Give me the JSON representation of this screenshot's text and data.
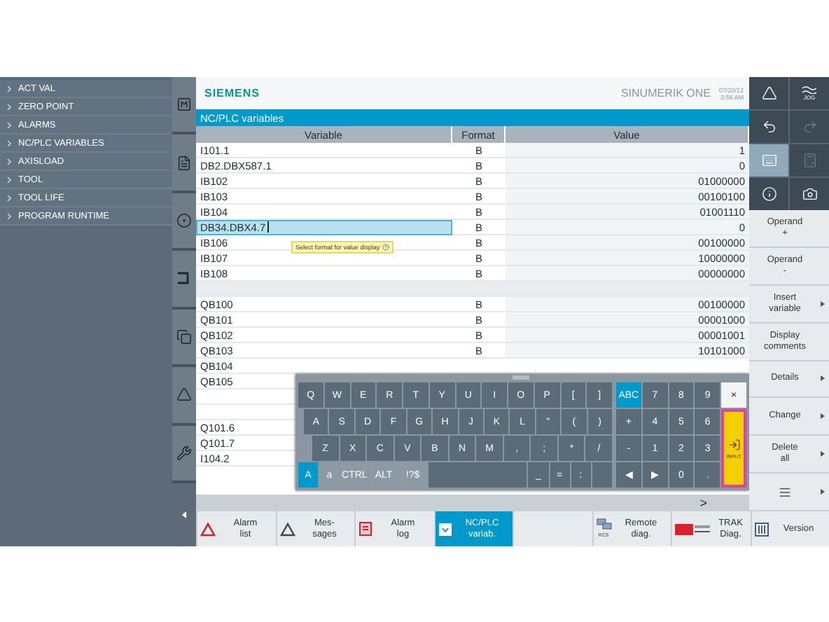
{
  "sidebar": {
    "items": [
      {
        "label": "ACT VAL"
      },
      {
        "label": "ZERO POINT"
      },
      {
        "label": "ALARMS"
      },
      {
        "label": "NC/PLC VARIABLES"
      },
      {
        "label": "AXISLOAD"
      },
      {
        "label": "TOOL"
      },
      {
        "label": "TOOL LIFE"
      },
      {
        "label": "PROGRAM RUNTIME"
      }
    ]
  },
  "header": {
    "brand": "SIEMENS",
    "product": "SINUMERIK ONE",
    "date": "07/20/12",
    "time": "3:56 AM"
  },
  "panel": {
    "title": "NC/PLC variables",
    "columns": [
      "Variable",
      "Format",
      "Value"
    ],
    "tooltip": "Select format for value display",
    "rows": [
      {
        "kind": "data",
        "variable": "I101.1",
        "format": "B",
        "value": "1",
        "selected": false
      },
      {
        "kind": "data",
        "variable": "DB2.DBX587.1",
        "format": "B",
        "value": "0",
        "selected": false
      },
      {
        "kind": "data",
        "variable": "IB102",
        "format": "B",
        "value": "01000000",
        "selected": false
      },
      {
        "kind": "data",
        "variable": "IB103",
        "format": "B",
        "value": "00100100",
        "selected": false
      },
      {
        "kind": "data",
        "variable": "IB104",
        "format": "B",
        "value": "01001110",
        "selected": false
      },
      {
        "kind": "data",
        "variable": "DB34.DBX4.7",
        "format": "B",
        "value": "0",
        "selected": true
      },
      {
        "kind": "data",
        "variable": "IB106",
        "format": "B",
        "value": "00100000",
        "selected": false
      },
      {
        "kind": "data",
        "variable": "IB107",
        "format": "B",
        "value": "10000000",
        "selected": false
      },
      {
        "kind": "data",
        "variable": "IB108",
        "format": "B",
        "value": "00000000",
        "selected": false
      },
      {
        "kind": "group",
        "selected": false
      },
      {
        "kind": "data",
        "variable": "QB100",
        "format": "B",
        "value": "00100000",
        "selected": false
      },
      {
        "kind": "data",
        "variable": "QB101",
        "format": "B",
        "value": "00001000",
        "selected": false
      },
      {
        "kind": "data",
        "variable": "QB102",
        "format": "B",
        "value": "00001001",
        "selected": false
      },
      {
        "kind": "data",
        "variable": "QB103",
        "format": "B",
        "value": "10101000",
        "selected": false
      },
      {
        "kind": "data",
        "variable": "QB104",
        "selected": false
      },
      {
        "kind": "data",
        "variable": "QB105",
        "selected": false
      },
      {
        "kind": "blank",
        "selected": false
      },
      {
        "kind": "blank",
        "selected": false
      },
      {
        "kind": "data",
        "variable": "Q101.6",
        "selected": false
      },
      {
        "kind": "data",
        "variable": "Q101.7",
        "selected": false
      },
      {
        "kind": "data",
        "variable": "I104.2",
        "selected": false
      }
    ],
    "page_arrow": ">"
  },
  "keyboard": {
    "input_label": "INPUT",
    "rows": [
      {
        "keys": [
          {
            "kind": "key",
            "label": "Q"
          },
          {
            "kind": "key",
            "label": "W"
          },
          {
            "kind": "key",
            "label": "E"
          },
          {
            "kind": "key",
            "label": "R"
          },
          {
            "kind": "key",
            "label": "T"
          },
          {
            "kind": "key",
            "label": "Y"
          },
          {
            "kind": "key",
            "label": "U"
          },
          {
            "kind": "key",
            "label": "I"
          },
          {
            "kind": "key",
            "label": "O"
          },
          {
            "kind": "key",
            "label": "P"
          },
          {
            "kind": "key",
            "label": "["
          },
          {
            "kind": "key",
            "label": "]"
          }
        ]
      },
      {
        "keys": [
          {
            "kind": "key",
            "label": "A"
          },
          {
            "kind": "key",
            "label": "S"
          },
          {
            "kind": "key",
            "label": "D"
          },
          {
            "kind": "key",
            "label": "F"
          },
          {
            "kind": "key",
            "label": "G"
          },
          {
            "kind": "key",
            "label": "H"
          },
          {
            "kind": "key",
            "label": "J"
          },
          {
            "kind": "key",
            "label": "K"
          },
          {
            "kind": "key",
            "label": "L"
          },
          {
            "kind": "key",
            "label": "\""
          },
          {
            "kind": "key",
            "label": "("
          },
          {
            "kind": "key",
            "label": ")"
          }
        ]
      },
      {
        "keys": [
          {
            "kind": "key",
            "label": "Z"
          },
          {
            "kind": "key",
            "label": "X"
          },
          {
            "kind": "key",
            "label": "C"
          },
          {
            "kind": "key",
            "label": "V"
          },
          {
            "kind": "key",
            "label": "B"
          },
          {
            "kind": "key",
            "label": "N"
          },
          {
            "kind": "key",
            "label": "M"
          },
          {
            "kind": "key",
            "label": ","
          },
          {
            "kind": "key",
            "label": ";"
          },
          {
            "kind": "key",
            "label": "*"
          },
          {
            "kind": "key",
            "label": "/"
          }
        ]
      },
      {
        "keys": [
          {
            "kind": "toggle",
            "label": "A",
            "selected": true
          },
          {
            "kind": "toggle",
            "label": "a",
            "selected": false
          },
          {
            "kind": "toggle",
            "label": "CTRL",
            "selected": false
          },
          {
            "kind": "toggle",
            "label": "ALT",
            "selected": false
          },
          {
            "kind": "toggle",
            "label": "!?$",
            "selected": false
          },
          {
            "kind": "space"
          },
          {
            "kind": "key",
            "label": "_"
          },
          {
            "kind": "key",
            "label": "="
          },
          {
            "kind": "key",
            "label": ":"
          },
          {
            "kind": "blank"
          }
        ]
      }
    ],
    "numpad": [
      {
        "keys": [
          {
            "kind": "toggle",
            "label": "ABC",
            "selected": true
          },
          {
            "kind": "key",
            "label": "7"
          },
          {
            "kind": "key",
            "label": "8"
          },
          {
            "kind": "key",
            "label": "9"
          },
          {
            "kind": "close",
            "label": "×"
          }
        ]
      },
      {
        "keys": [
          {
            "kind": "key",
            "label": "+"
          },
          {
            "kind": "key",
            "label": "4"
          },
          {
            "kind": "key",
            "label": "5"
          },
          {
            "kind": "key",
            "label": "6"
          }
        ]
      },
      {
        "keys": [
          {
            "kind": "key",
            "label": "-"
          },
          {
            "kind": "key",
            "label": "1"
          },
          {
            "kind": "key",
            "label": "2"
          },
          {
            "kind": "key",
            "label": "3"
          }
        ]
      },
      {
        "keys": [
          {
            "kind": "key",
            "label": "◀"
          },
          {
            "kind": "key",
            "label": "▶"
          },
          {
            "kind": "key",
            "label": "0"
          },
          {
            "kind": "key",
            "label": "."
          }
        ]
      }
    ]
  },
  "quick_buttons": [
    {
      "kind": "machine",
      "selected": false,
      "disabled": false
    },
    {
      "kind": "jog",
      "label": "JOG",
      "selected": false,
      "disabled": false
    },
    {
      "kind": "undo",
      "selected": false,
      "disabled": false
    },
    {
      "kind": "redo",
      "selected": false,
      "disabled": true
    },
    {
      "kind": "keyboard",
      "selected": true,
      "disabled": false
    },
    {
      "kind": "calculator",
      "selected": false,
      "disabled": true
    },
    {
      "kind": "info",
      "selected": false,
      "disabled": false
    },
    {
      "kind": "screenshot",
      "selected": false,
      "disabled": false
    }
  ],
  "softkeys": [
    {
      "kind": "text",
      "label": "Operand\n+",
      "arrow": false
    },
    {
      "kind": "text",
      "label": "Operand\n-",
      "arrow": false
    },
    {
      "kind": "text",
      "label": "Insert\nvariable",
      "arrow": true
    },
    {
      "kind": "text",
      "label": "Display\ncomments",
      "arrow": false
    },
    {
      "kind": "text",
      "label": "Details",
      "arrow": true
    },
    {
      "kind": "text",
      "label": "Change",
      "arrow": true
    },
    {
      "kind": "text",
      "label": "Delete\nall",
      "arrow": true
    },
    {
      "kind": "more",
      "arrow": true
    }
  ],
  "bottom_softkeys": [
    {
      "kind": "alarm",
      "label": "Alarm\nlist",
      "selected": false
    },
    {
      "kind": "messages",
      "label": "Mes-\nsages",
      "selected": false
    },
    {
      "kind": "log",
      "label": "Alarm\nlog",
      "selected": false
    },
    {
      "kind": "variables",
      "label": "NC/PLC\nvariab.",
      "selected": true
    },
    {
      "kind": "empty",
      "selected": false
    },
    {
      "kind": "remote",
      "label": "Remote\ndiag.",
      "badge": "RCS",
      "selected": false
    },
    {
      "kind": "trak",
      "label": "TRAK\nDiag.",
      "selected": false
    },
    {
      "kind": "version",
      "label": "Version",
      "selected": false
    }
  ]
}
